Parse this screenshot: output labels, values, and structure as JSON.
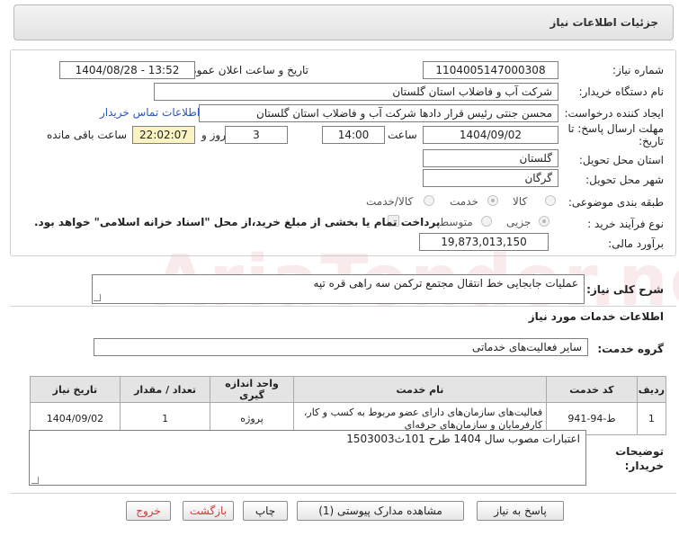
{
  "header": {
    "title": "جزئیات اطلاعات نیاز"
  },
  "fields": {
    "need_number_label": "شماره نیاز:",
    "need_number": "1104005147000308",
    "announce_label": "تاریخ و ساعت اعلان عمومی:",
    "announce_value": "1404/08/28 - 13:52",
    "buyer_org_label": "نام دستگاه خریدار:",
    "buyer_org": "شرکت آب و فاضلاب استان گلستان",
    "creator_label": "ایجاد کننده درخواست:",
    "creator": "محسن جنتی رئیس قرار دادها شرکت آب و فاضلاب استان گلستان",
    "contact_link": "اطلاعات تماس خریدار",
    "deadline_label": "مهلت ارسال پاسخ: تا تاریخ:",
    "deadline_date": "1404/09/02",
    "time_label": "ساعت",
    "deadline_time": "14:00",
    "days_value": "3",
    "days_label": "روز و",
    "remaining_time": "22:02:07",
    "remaining_label": "ساعت باقی مانده",
    "province_label": "استان محل تحویل:",
    "province": "گلستان",
    "city_label": "شهر محل تحویل:",
    "city": "گرگان",
    "category_label": "طبقه بندی موضوعی:",
    "category_options": [
      "کالا",
      "خدمت",
      "کالا/خدمت"
    ],
    "purchase_type_label": "نوع فرآیند خرید :",
    "purchase_options": [
      "جزیی",
      "متوسط"
    ],
    "payment_note": "پرداخت تمام یا بخشی از مبلغ خرید،از محل \"اسناد خزانه اسلامی\" خواهد بود.",
    "estimate_label": "برآورد مالی:",
    "estimate": "19,873,013,150"
  },
  "description": {
    "label": "شرح کلی نیاز:",
    "value": "عملیات جابجایی خط انتقال مجتمع ترکمن سه راهی قره تپه"
  },
  "services": {
    "section_title": "اطلاعات خدمات مورد نیاز",
    "group_label": "گروه خدمت:",
    "group_value": "سایر فعالیت‌های خدماتی"
  },
  "table": {
    "headers": [
      "ردیف",
      "کد خدمت",
      "نام خدمت",
      "واحد اندازه گیری",
      "تعداد / مقدار",
      "تاریخ نیاز"
    ],
    "rows": [
      [
        "1",
        "ط-94-941",
        "فعالیت‌های سازمان‌های دارای عضو مربوط به کسب و کار، کارفرمایان و سازمان‌های حرفه‌ای",
        "پروژه",
        "1",
        "1404/09/02"
      ]
    ]
  },
  "buyer_notes": {
    "label": "توضیحات خریدار:",
    "value": "اعتبارات مصوب سال 1404 طرح 101ث1503003"
  },
  "buttons": {
    "reply": "پاسخ به نیاز",
    "attachments": "مشاهده مدارک پیوستی (1)",
    "print": "چاپ",
    "back": "بازگشت",
    "exit": "خروج"
  },
  "watermark": "AriaTender.net",
  "colors": {
    "link": "#2b56b5",
    "highlight": "#fbf4c2",
    "danger": "#c73a3a"
  }
}
